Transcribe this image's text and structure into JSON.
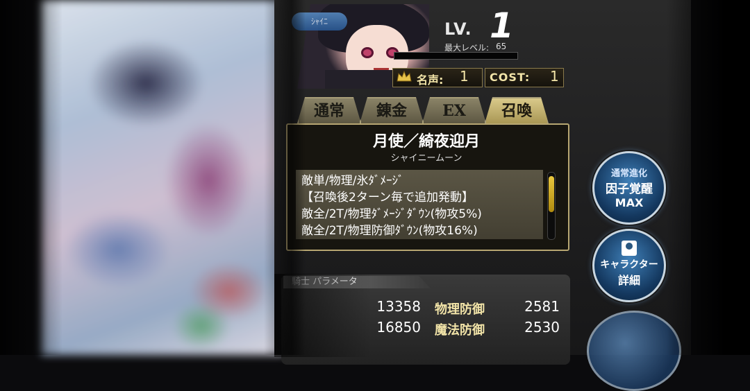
{
  "header": {
    "badge": "ｼｬｲﾆ",
    "level_label": "LV.",
    "level_value": "1",
    "max_level_label": "最大レベル:",
    "max_level_value": "65",
    "fame_label": "名声:",
    "fame_value": "1",
    "cost_label": "COST:",
    "cost_value": "1"
  },
  "tabs": [
    {
      "label": "通常",
      "active": false
    },
    {
      "label": "錬金",
      "active": false
    },
    {
      "label": "EX",
      "active": false
    },
    {
      "label": "召喚",
      "active": true
    }
  ],
  "skill": {
    "name": "月使／綺夜迎月",
    "reading": "シャイニームーン",
    "description_lines": [
      "敵単/物理/氷ﾀﾞﾒｰｼﾞ",
      "【召喚後2ターン毎で追加発動】",
      "敵全/2T/物理ﾀﾞﾒｰｼﾞﾀﾞｳﾝ(物攻5%)",
      "敵全/2T/物理防御ﾀﾞｳﾝ(物攻16%)"
    ]
  },
  "buttons": {
    "awaken": {
      "line1": "通常進化",
      "line2": "因子覚醒",
      "line3": "MAX"
    },
    "detail": {
      "line1": "キャラクター",
      "line2": "詳細"
    }
  },
  "params": {
    "header": "騎士 パラメータ",
    "hp_value": "13358",
    "atk_value": "16850",
    "pdef_label": "物理防御",
    "pdef_value": "2581",
    "mdef_label": "魔法防御",
    "mdef_value": "2530"
  },
  "icons": {
    "crown": "crown-icon",
    "character": "character-icon"
  },
  "colors": {
    "gold_text": "#f2e4a8",
    "active_tab": "#d9c98a",
    "scroll_thumb": "#e9c73e",
    "button_blue": "#3f7fb7"
  }
}
